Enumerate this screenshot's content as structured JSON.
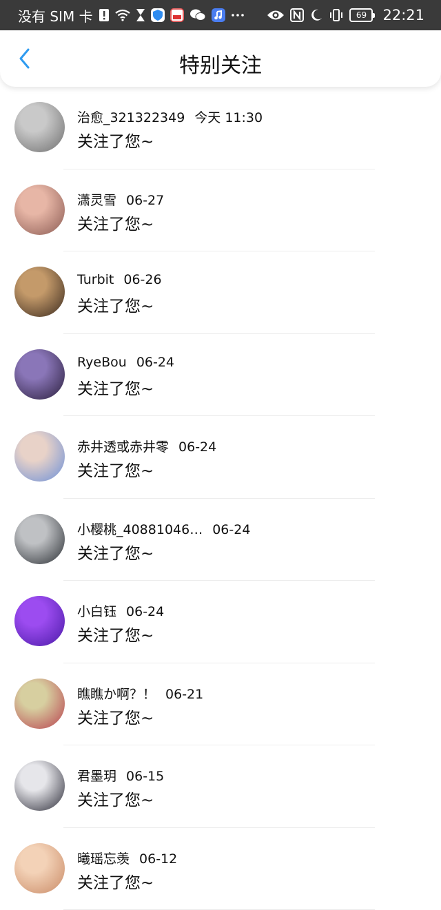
{
  "status_bar": {
    "carrier": "没有 SIM 卡",
    "time": "22:21",
    "battery": "69",
    "icons": [
      "sim-warning-icon",
      "wifi-icon",
      "hourglass-icon",
      "shield-app-icon",
      "tousu-app-icon",
      "wechat-icon",
      "music-app-icon",
      "more-icon",
      "eye-icon",
      "nfc-icon",
      "moon-icon",
      "vibrate-icon",
      "battery-icon"
    ]
  },
  "header": {
    "title": "特别关注",
    "back_icon": "chevron-left-icon",
    "accent": "#2f9bf0"
  },
  "items": [
    {
      "name": "治愈_321322349",
      "date": "今天 11:30",
      "message": "关注了您~",
      "colors": [
        "#c9c9c9",
        "#6e6e6e"
      ]
    },
    {
      "name": "潇灵雪",
      "date": "06-27",
      "message": "关注了您~",
      "colors": [
        "#e7b6a6",
        "#8a5a52"
      ]
    },
    {
      "name": "Turbit",
      "date": "06-26",
      "message": "关注了您~",
      "colors": [
        "#c49a6a",
        "#3a2a1e"
      ]
    },
    {
      "name": "RyeBou",
      "date": "06-24",
      "message": "关注了您~",
      "colors": [
        "#8a76b8",
        "#2a1e3c"
      ]
    },
    {
      "name": "赤井透或赤井零",
      "date": "06-24",
      "message": "关注了您~",
      "colors": [
        "#e8d2c8",
        "#6b8fd8"
      ]
    },
    {
      "name": "小樱桃_40881046…",
      "date": "06-24",
      "message": "关注了您~",
      "colors": [
        "#bfc1c4",
        "#2b2f34"
      ]
    },
    {
      "name": "小白钰",
      "date": "06-24",
      "message": "关注了您~",
      "colors": [
        "#9c4cf0",
        "#4a1aa6"
      ]
    },
    {
      "name": "瞧瞧か啊？！",
      "date": "06-21",
      "message": "关注了您~",
      "colors": [
        "#d7cfa0",
        "#b8404e"
      ]
    },
    {
      "name": "君墨玥",
      "date": "06-15",
      "message": "关注了您~",
      "colors": [
        "#e6e6ea",
        "#2c2c38"
      ]
    },
    {
      "name": "曦瑶忘羡",
      "date": "06-12",
      "message": "关注了您~",
      "colors": [
        "#f3d2b7",
        "#c98a66"
      ]
    }
  ]
}
